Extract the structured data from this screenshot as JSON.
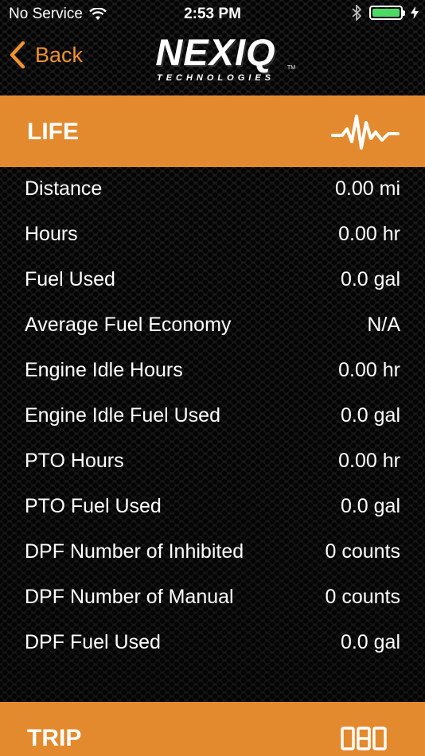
{
  "status_bar": {
    "carrier": "No Service",
    "time": "2:53 PM",
    "battery_color": "#4cd964"
  },
  "nav": {
    "back_label": "Back",
    "logo_text": "NEXIQ",
    "logo_subtext": "TECHNOLOGIES",
    "logo_tm": "TM",
    "accent_color": "#f0922f"
  },
  "life_section": {
    "title": "LIFE",
    "icon": "pulse-waveform-icon",
    "header_color": "#e48a2e",
    "rows": [
      {
        "label": "Distance",
        "value": "0.00 mi"
      },
      {
        "label": "Hours",
        "value": "0.00 hr"
      },
      {
        "label": "Fuel Used",
        "value": "0.0 gal"
      },
      {
        "label": "Average Fuel Economy",
        "value": "N/A"
      },
      {
        "label": "Engine Idle Hours",
        "value": "0.00 hr"
      },
      {
        "label": "Engine Idle Fuel Used",
        "value": "0.0 gal"
      },
      {
        "label": "PTO Hours",
        "value": "0.00 hr"
      },
      {
        "label": "PTO Fuel Used",
        "value": "0.0 gal"
      },
      {
        "label": "DPF Number of Inhibited",
        "value": "0 counts"
      },
      {
        "label": "DPF Number of Manual",
        "value": "0 counts"
      },
      {
        "label": "DPF Fuel Used",
        "value": "0.0 gal"
      }
    ]
  },
  "trip_section": {
    "title": "TRIP",
    "icon": "trip-odometer-icon",
    "icon_text": "080"
  }
}
